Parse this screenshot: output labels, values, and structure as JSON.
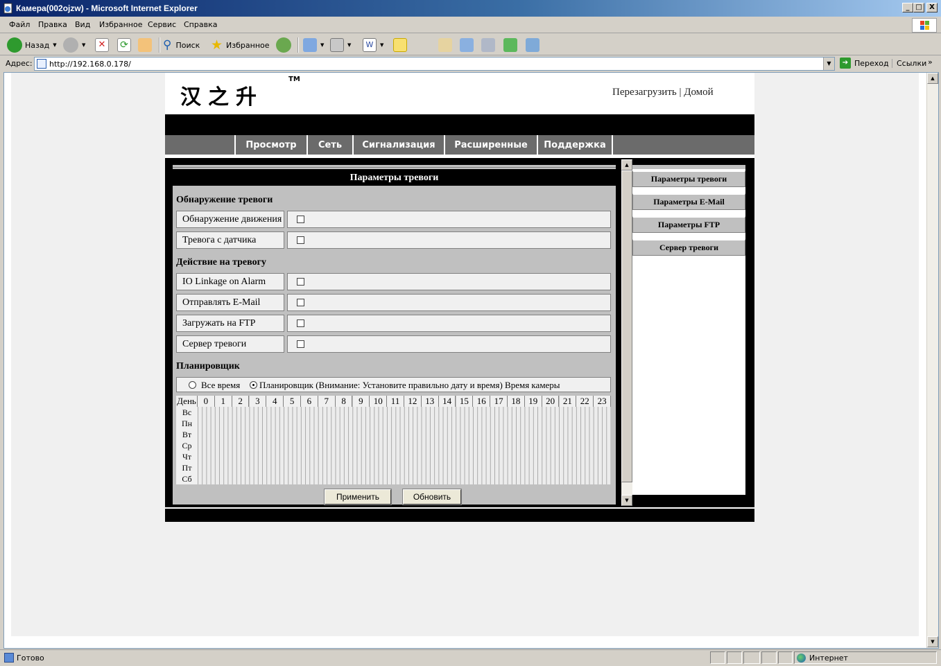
{
  "window": {
    "title": "Камера(002ojzw) - Microsoft Internet Explorer",
    "minimize": "_",
    "maximize": "□",
    "close": "X"
  },
  "menu": [
    "Файл",
    "Правка",
    "Вид",
    "Избранное",
    "Сервис",
    "Справка"
  ],
  "toolbar": {
    "back": "Назад",
    "search": "Поиск",
    "favorites": "Избранное"
  },
  "address": {
    "label": "Адрес:",
    "url": "http://192.168.0.178/",
    "go": "Переход",
    "links": "Ссылки"
  },
  "camera": {
    "logo": "汉之升",
    "tm": "TM",
    "reboot": "Перезагрузить",
    "separator": "|",
    "home": "Домой",
    "nav": [
      "Просмотр",
      "Сеть",
      "Сигнализация",
      "Расширенные",
      "Поддержка"
    ],
    "panel_title": "Параметры тревоги",
    "section_detection": "Обнаружение тревоги",
    "detection_rows": [
      {
        "label": "Обнаружение движения",
        "checked": false
      },
      {
        "label": "Тревога с датчика",
        "checked": false
      }
    ],
    "section_action": "Действие на тревогу",
    "action_rows": [
      {
        "label": "IO Linkage on Alarm",
        "checked": false
      },
      {
        "label": "Отправлять E-Mail",
        "checked": false
      },
      {
        "label": "Загружать на FTP",
        "checked": false
      },
      {
        "label": "Сервер тревоги",
        "checked": false
      }
    ],
    "section_scheduler": "Планировщик",
    "radio_all": "Все время",
    "radio_sched": "Планировщик (Внимание: Установите правильно дату и время) Время камеры",
    "radio_selected": "scheduler",
    "grid_day_header": "День",
    "hours": [
      "0",
      "1",
      "2",
      "3",
      "4",
      "5",
      "6",
      "7",
      "8",
      "9",
      "10",
      "11",
      "12",
      "13",
      "14",
      "15",
      "16",
      "17",
      "18",
      "19",
      "20",
      "21",
      "22",
      "23"
    ],
    "days": [
      "Вс",
      "Пн",
      "Вт",
      "Ср",
      "Чт",
      "Пт",
      "Сб"
    ],
    "apply": "Применить",
    "refresh": "Обновить",
    "side_menu": [
      "Параметры тревоги",
      "Параметры E-Mail",
      "Параметры FTP",
      "Сервер тревоги"
    ]
  },
  "status": {
    "text": "Готово",
    "zone": "Интернет"
  }
}
